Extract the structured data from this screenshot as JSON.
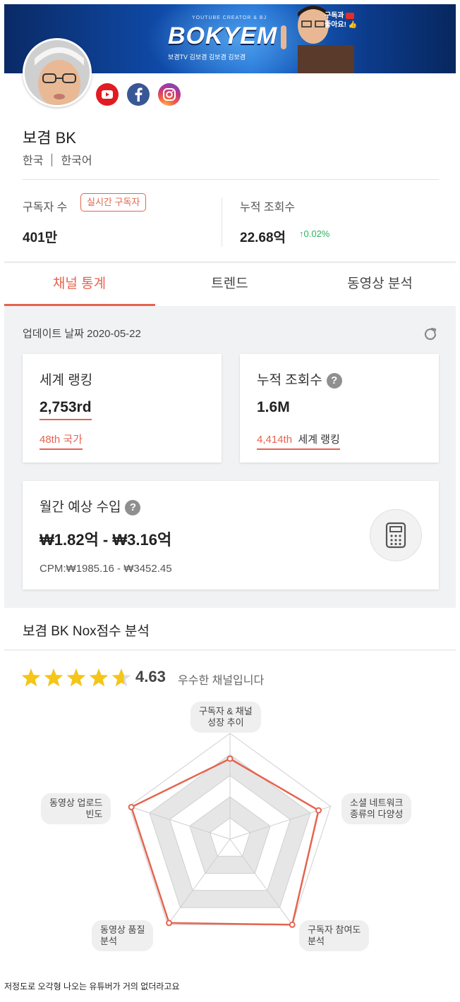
{
  "banner": {
    "kicker": "YOUTUBE CREATOR & BJ",
    "brand": "BOKYEM",
    "social_strip": "보겸TV  김보겸  김보겸  김보겸",
    "subscribe_line1": "구독과",
    "subscribe_line2": "좋아요!"
  },
  "channel": {
    "name": "보겸 BK",
    "country": "한국",
    "language": "한국어"
  },
  "stats": {
    "subscribers_label": "구독자 수",
    "live_badge": "실시간 구독자",
    "subscribers_value": "401만",
    "views_label": "누적 조회수",
    "views_value": "22.68억",
    "views_growth": "0.02%"
  },
  "tabs": [
    "채널 통계",
    "트렌드",
    "동영상 분석"
  ],
  "update": {
    "label": "업데이트 날짜 2020-05-22"
  },
  "cards": {
    "world_rank_title": "세계 랭킹",
    "world_rank_value": "2,753rd",
    "country_rank": "48th 국가",
    "views_title": "누적 조회수",
    "views_value": "1.6M",
    "views_rank_num": "4,414th",
    "views_rank_label": "세계 랭킹",
    "income_title": "월간 예상 수입",
    "income_value": "₩1.82억 - ₩3.16억",
    "cpm": "CPM:₩1985.16 - ₩3452.45"
  },
  "nox": {
    "title": "보겸 BK Nox점수 분석",
    "rating": 4.63,
    "score_text": "4.63",
    "score_desc": "우수한 채널입니다",
    "radar_labels": {
      "top": [
        "구독자 & 채널",
        "성장 추이"
      ],
      "right": [
        "소셜 네트워크",
        "종류의 다양성"
      ],
      "bottom_right": [
        "구독자 참여도",
        "분석"
      ],
      "bottom_left": [
        "동영상 품질",
        "분석"
      ],
      "left": [
        "동영상 업로드",
        "빈도"
      ]
    },
    "radar_values": [
      0.76,
      0.88,
      1.0,
      0.98,
      0.98
    ]
  },
  "colors": {
    "accent": "#e5644f",
    "growth": "#2db15e",
    "star": "#f5c518"
  },
  "caption": "저정도로 오각형 나오는 유튜버가 거의 없더라고요"
}
